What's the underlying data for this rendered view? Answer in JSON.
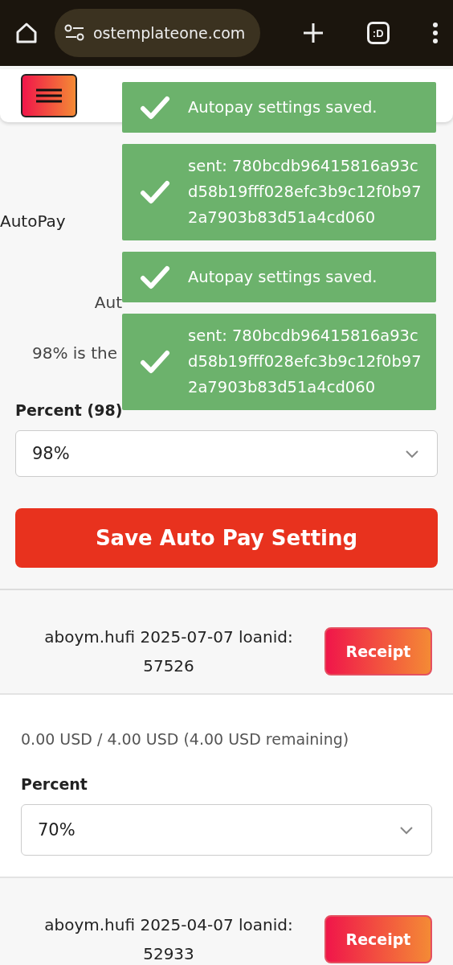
{
  "browser": {
    "url": "ostemplateone.com",
    "tab_label": ":D"
  },
  "section_title": "AutoPay",
  "balance": "Aut",
  "note": "98% is the",
  "percent_label": "Percent (98)",
  "percent_value": "98%",
  "save_button": "Save Auto Pay Setting",
  "loans": [
    {
      "title": "aboym.hufi 2025-07-07 loanid: 57526",
      "receipt": "Receipt",
      "details": {
        "amount": "0.00 USD / 4.00 USD (4.00 USD remaining)",
        "percent_label": "Percent",
        "percent_value": "70%"
      }
    },
    {
      "title": "aboym.hufi 2025-04-07 loanid: 52933",
      "receipt": "Receipt"
    }
  ],
  "toasts": [
    {
      "message": "Autopay settings saved."
    },
    {
      "message": "sent: 780bcdb96415816a93cd58b19fff028efc3b9c12f0b972a7903b83d51a4cd060"
    },
    {
      "message": "Autopay settings saved."
    },
    {
      "message": "sent: 780bcdb96415816a93cd58b19fff028efc3b9c12f0b972a7903b83d51a4cd060"
    }
  ]
}
